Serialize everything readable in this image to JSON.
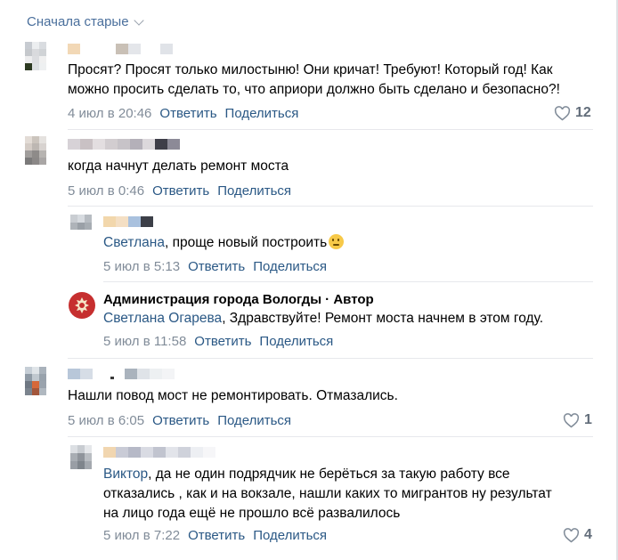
{
  "sort_label": "Сначала старые",
  "actions": {
    "reply": "Ответить",
    "share": "Поделиться"
  },
  "comments": [
    {
      "text_lines": [
        "Просят? Просят только милостыню! Они кричат! Требуют! Который год! Как",
        "можно просить сделать то, что априори должно быть сделано и безопасно?!"
      ],
      "date": "4 июл в 20:46",
      "likes": "12"
    },
    {
      "text_lines": [
        "когда начнут делать ремонт моста"
      ],
      "date": "5 июл в 0:46",
      "likes": ""
    },
    {
      "mention": "Светлана",
      "text": ", проще новый построить",
      "date": "5 июл в 5:13",
      "likes": ""
    },
    {
      "author": "Администрация города Вологды · Автор",
      "mention": "Светлана Огарева",
      "text": ", Здравствуйте! Ремонт моста начнем в этом году.",
      "date": "5 июл в 11:58",
      "likes": ""
    },
    {
      "text_lines": [
        "Нашли повод мост не ремонтировать. Отмазались."
      ],
      "date": "5 июл в 6:05",
      "likes": "1"
    },
    {
      "mention": "Виктор",
      "text_first": ", да не один подрядчик не берёться за такую работу все",
      "text_lines_rest": [
        "отказались , как и на вокзале, нашли каких то мигрантов ну результат",
        "на лицо года ещё не прошло всё развалилось"
      ],
      "date": "5 июл в 7:22",
      "likes": "4"
    }
  ],
  "icons": {
    "like": "heart-outline-icon",
    "sort": "chevron-down-icon",
    "author_avatar": "city-coat-of-arms-icon",
    "emoji": "thinking-face-emoji"
  },
  "colors": {
    "link": "#2a5885",
    "meta": "#818c99",
    "sort_link": "#4a6f9c",
    "divider": "#e7e8ec",
    "like": "#626d7a"
  }
}
